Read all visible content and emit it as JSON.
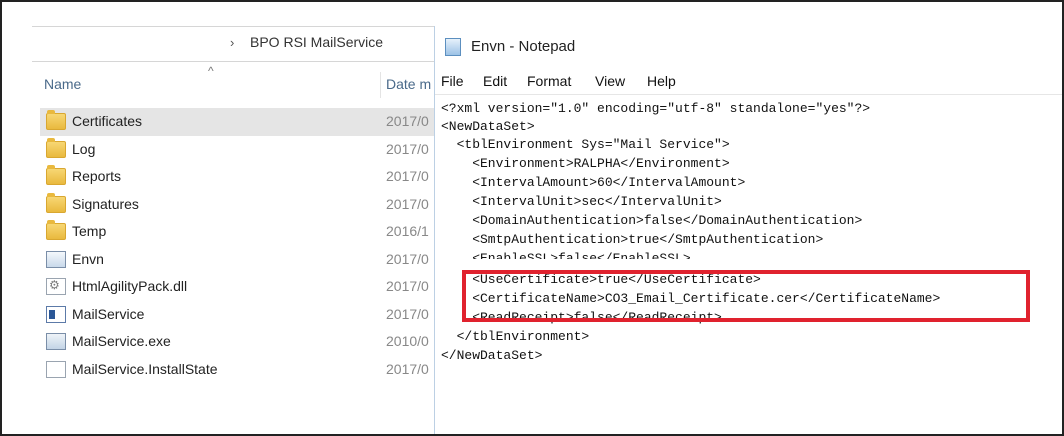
{
  "explorer": {
    "breadcrumb": "BPO RSI MailService",
    "breadcrumb_chevron": "›",
    "columns": {
      "name": "Name",
      "date": "Date m",
      "sort_caret": "^"
    },
    "files": [
      {
        "name": "Certificates",
        "date": "2017/0",
        "icon": "folder-icon",
        "selected": true
      },
      {
        "name": "Log",
        "date": "2017/0",
        "icon": "folder-icon"
      },
      {
        "name": "Reports",
        "date": "2017/0",
        "icon": "folder-icon"
      },
      {
        "name": "Signatures",
        "date": "2017/0",
        "icon": "folder-icon"
      },
      {
        "name": "Temp",
        "date": "2016/1",
        "icon": "folder-icon"
      },
      {
        "name": "Envn",
        "date": "2017/0",
        "icon": "config-file-icon"
      },
      {
        "name": "HtmlAgilityPack.dll",
        "date": "2017/0",
        "icon": "dll-file-icon"
      },
      {
        "name": "MailService",
        "date": "2017/0",
        "icon": "application-icon"
      },
      {
        "name": "MailService.exe",
        "date": "2010/0",
        "icon": "exe-file-icon"
      },
      {
        "name": "MailService.InstallState",
        "date": "2017/0",
        "icon": "blank-file-icon"
      }
    ]
  },
  "notepad": {
    "title": "Envn - Notepad",
    "menu": [
      "File",
      "Edit",
      "Format",
      "View",
      "Help"
    ],
    "lines": [
      "<?xml version=\"1.0\" encoding=\"utf-8\" standalone=\"yes\"?>",
      "<NewDataSet>",
      "  <tblEnvironment Sys=\"Mail Service\">",
      "    <Environment>RALPHA</Environment>",
      "    <IntervalAmount>60</IntervalAmount>",
      "    <IntervalUnit>sec</IntervalUnit>",
      "    <DomainAuthentication>false</DomainAuthentication>",
      "    <SmtpAuthentication>true</SmtpAuthentication>",
      "    <EnableSSL>false</EnableSSL>",
      "    <UseCertificate>true</UseCertificate>",
      "    <CertificateName>CO3_Email_Certificate.cer</CertificateName>",
      "    <ReadReceipt>false</ReadReceipt>",
      "  </tblEnvironment>",
      "</NewDataSet>"
    ],
    "highlight_color": "#e0222e"
  }
}
